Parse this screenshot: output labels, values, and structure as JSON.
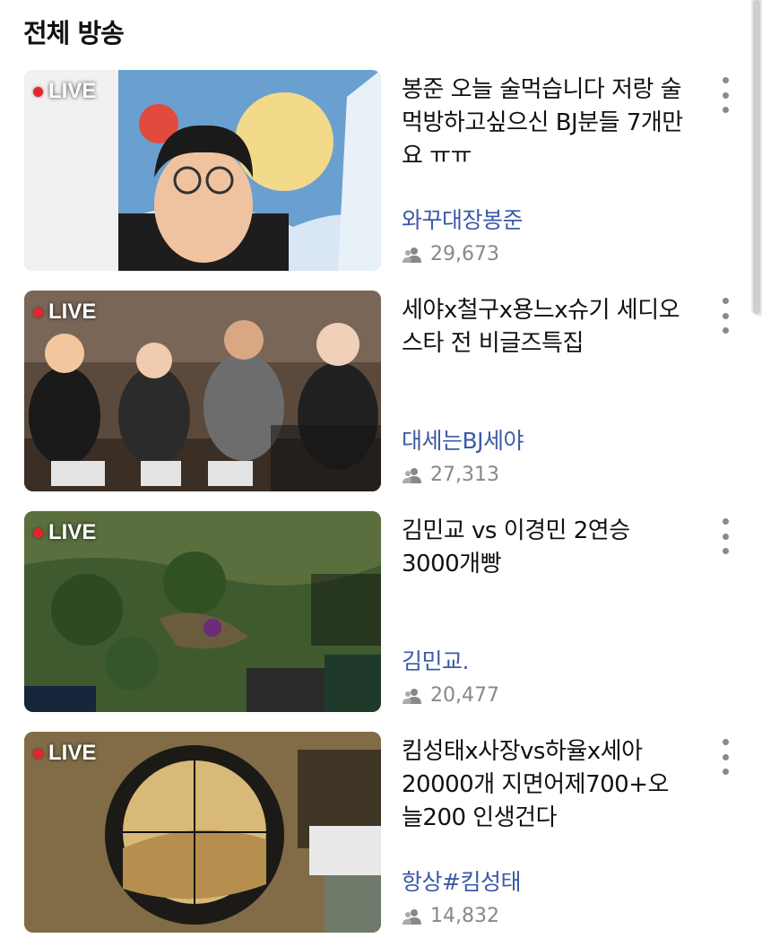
{
  "section": {
    "title": "전체 방송"
  },
  "live_label": "LIVE",
  "accent": {
    "channel_color": "#3e5aa6",
    "live_dot_color": "#e8242b",
    "viewer_color": "#888888"
  },
  "icons": {
    "viewers": "people-icon",
    "more": "more-vert-icon",
    "live": "red-dot-icon"
  },
  "broadcasts": [
    {
      "title": "봉준 오늘 술먹습니다 저랑 술먹방하고싶으신 BJ분들 7개만요 ㅠㅠ",
      "channel": "와꾸대장봉준",
      "viewers": "29,673"
    },
    {
      "title": "세야x철구x용느x슈기 세디오스타 전 비글즈특집",
      "channel": "대세는BJ세야",
      "viewers": "27,313"
    },
    {
      "title": "김민교 vs 이경민 2연승 3000개빵",
      "channel": "김민교.",
      "viewers": "20,477"
    },
    {
      "title": "킴성태x사장vs하율x세아 20000개 지면어제700+오늘200 인생건다",
      "channel": "항상#킴성태",
      "viewers": "14,832"
    }
  ]
}
